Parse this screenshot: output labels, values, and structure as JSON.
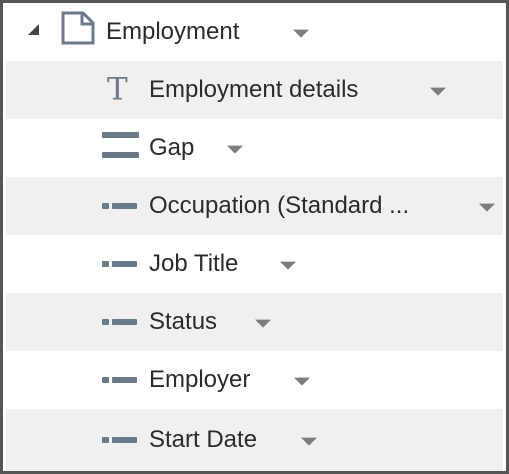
{
  "tree": {
    "root": {
      "label": "Employment",
      "icon": "page-icon"
    },
    "items": [
      {
        "label": "Employment details",
        "icon": "text-icon"
      },
      {
        "label": "Gap",
        "icon": "gap-icon"
      },
      {
        "label": "Occupation (Standard ...",
        "icon": "field-icon"
      },
      {
        "label": "Job Title",
        "icon": "field-icon"
      },
      {
        "label": "Status",
        "icon": "field-icon"
      },
      {
        "label": "Employer",
        "icon": "field-icon"
      },
      {
        "label": "Start Date",
        "icon": "field-icon"
      }
    ],
    "text_icon_glyph": "T"
  },
  "colors": {
    "icon": "#6b7a88",
    "row_alt": "#f0f0f0",
    "border": "#555555",
    "text": "#2b2b2b"
  }
}
